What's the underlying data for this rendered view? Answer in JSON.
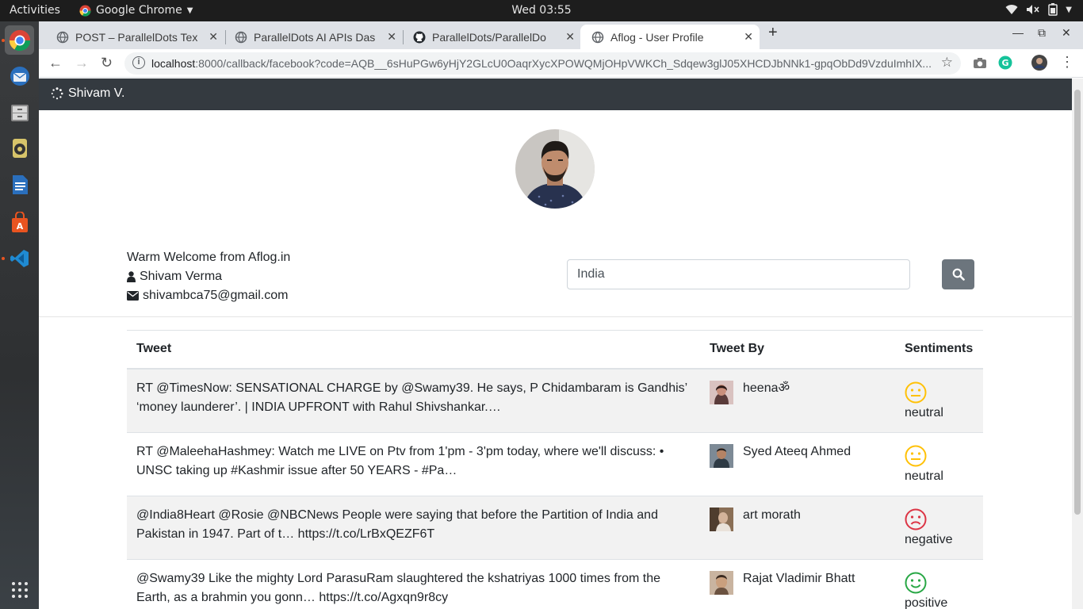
{
  "desktop": {
    "activities": "Activities",
    "app_name": "Google Chrome",
    "clock": "Wed 03:55"
  },
  "browser": {
    "tabs": [
      {
        "label": "POST – ParallelDots Tex",
        "active": false
      },
      {
        "label": "ParallelDots AI APIs Das",
        "active": false
      },
      {
        "label": "ParallelDots/ParallelDo",
        "active": false
      },
      {
        "label": "Aflog - User Profile",
        "active": true
      }
    ],
    "url_host": "localhost",
    "url_rest": ":8000/callback/facebook?code=AQB__6sHuPGw6yHjY2GLcU0OaqrXycXPOWQMjOHpVWKCh_Sdqew3glJ05XHCDJbNNk1-gpqObDd9VzduImhIX..."
  },
  "navbar": {
    "brand": "Shivam V."
  },
  "profile": {
    "welcome": "Warm Welcome from Aflog.in",
    "name": "Shivam Verma",
    "email": "shivambca75@gmail.com"
  },
  "search": {
    "value": "India"
  },
  "table": {
    "headers": {
      "tweet": "Tweet",
      "by": "Tweet By",
      "sentiment": "Sentiments"
    },
    "rows": [
      {
        "tweet": "RT @TimesNow: SENSATIONAL CHARGE by @Swamy39. He says, P Chidambaram is Gandhis’ ‘money launderer’. | INDIA UPFRONT with Rahul Shivshankar.…",
        "by": "heenaॐ",
        "sentiment": "neutral",
        "sentiment_color": "#ffc107"
      },
      {
        "tweet": "RT @MaleehaHashmey: Watch me LIVE on Ptv from 1'pm - 3'pm today, where we'll discuss: • UNSC taking up #Kashmir issue after 50 YEARS - #Pa…",
        "by": "Syed Ateeq Ahmed",
        "sentiment": "neutral",
        "sentiment_color": "#ffc107"
      },
      {
        "tweet": "@India8Heart @Rosie @NBCNews People were saying that before the Partition of India and Pakistan in 1947. Part of t… https://t.co/LrBxQEZF6T",
        "by": "art morath",
        "sentiment": "negative",
        "sentiment_color": "#dc3545"
      },
      {
        "tweet": "@Swamy39 Like the mighty Lord ParasuRam slaughtered the kshatriyas 1000 times from the Earth, as a brahmin you gonn… https://t.co/Agxqn9r8cy",
        "by": "Rajat Vladimir Bhatt",
        "sentiment": "positive",
        "sentiment_color": "#28a745"
      }
    ]
  }
}
